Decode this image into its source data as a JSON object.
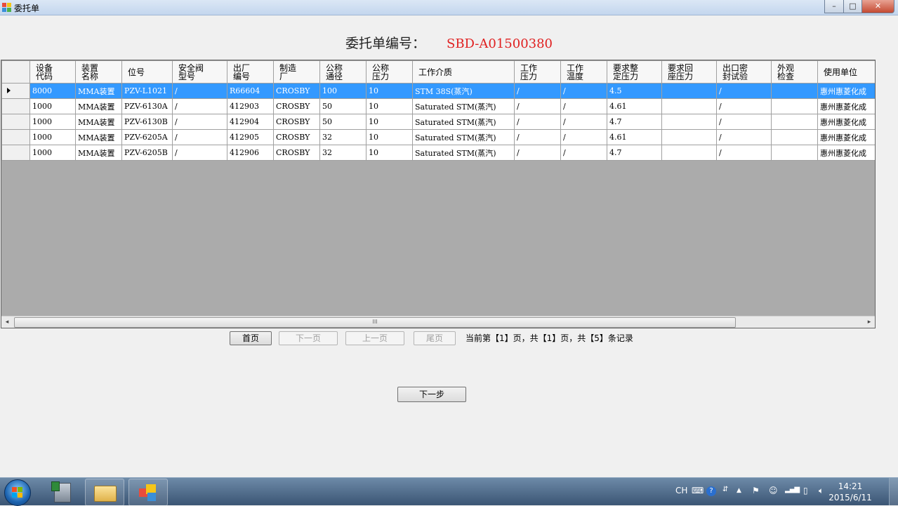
{
  "window": {
    "title": "委托单",
    "minimize_glyph": "–",
    "maximize_glyph": "□",
    "close_glyph": "✕"
  },
  "header": {
    "label": "委托单编号：",
    "number": "SBD-A01500380"
  },
  "grid": {
    "columns": [
      "设备\n代码",
      "装置\n名称",
      "位号",
      "安全阀\n型号",
      "出厂\n编号",
      "制造\n厂",
      "公称\n通径",
      "公称\n压力",
      "工作介质",
      "工作\n压力",
      "工作\n温度",
      "要求整\n定压力",
      "要求回\n座压力",
      "出口密\n封试验",
      "外观\n检查",
      "使用单位"
    ],
    "rows": [
      [
        "8000",
        "MMA装置",
        "PZV-L1021",
        "/",
        "R66604",
        "CROSBY",
        "100",
        "10",
        "STM 38S(蒸汽)",
        "/",
        "/",
        "4.5",
        "",
        "/",
        "",
        "惠州惠菱化成"
      ],
      [
        "1000",
        "MMA装置",
        "PZV-6130A",
        "/",
        "412903",
        "CROSBY",
        "50",
        "10",
        "Saturated STM(蒸汽)",
        "/",
        "/",
        "4.61",
        "",
        "/",
        "",
        "惠州惠菱化成"
      ],
      [
        "1000",
        "MMA装置",
        "PZV-6130B",
        "/",
        "412904",
        "CROSBY",
        "50",
        "10",
        "Saturated STM(蒸汽)",
        "/",
        "/",
        "4.7",
        "",
        "/",
        "",
        "惠州惠菱化成"
      ],
      [
        "1000",
        "MMA装置",
        "PZV-6205A",
        "/",
        "412905",
        "CROSBY",
        "32",
        "10",
        "Saturated STM(蒸汽)",
        "/",
        "/",
        "4.61",
        "",
        "/",
        "",
        "惠州惠菱化成"
      ],
      [
        "1000",
        "MMA装置",
        "PZV-6205B",
        "/",
        "412906",
        "CROSBY",
        "32",
        "10",
        "Saturated STM(蒸汽)",
        "/",
        "/",
        "4.7",
        "",
        "/",
        "",
        "惠州惠菱化成"
      ]
    ],
    "selected_row": 0,
    "scroll_left_glyph": "◂",
    "scroll_right_glyph": "▸",
    "scroll_thumb_glyph": "III"
  },
  "pager": {
    "first": "首页",
    "next": "下一页",
    "prev": "上一页",
    "last": "尾页",
    "status": "当前第【1】页，共【1】页，共【5】条记录"
  },
  "next_step": "下一步",
  "taskbar": {
    "lang": "CH",
    "time": "14:21",
    "date": "2015/6/11"
  },
  "colors": {
    "accent_selected": "#3399ff",
    "header_number": "#e02020",
    "grid_empty": "#ababab"
  }
}
